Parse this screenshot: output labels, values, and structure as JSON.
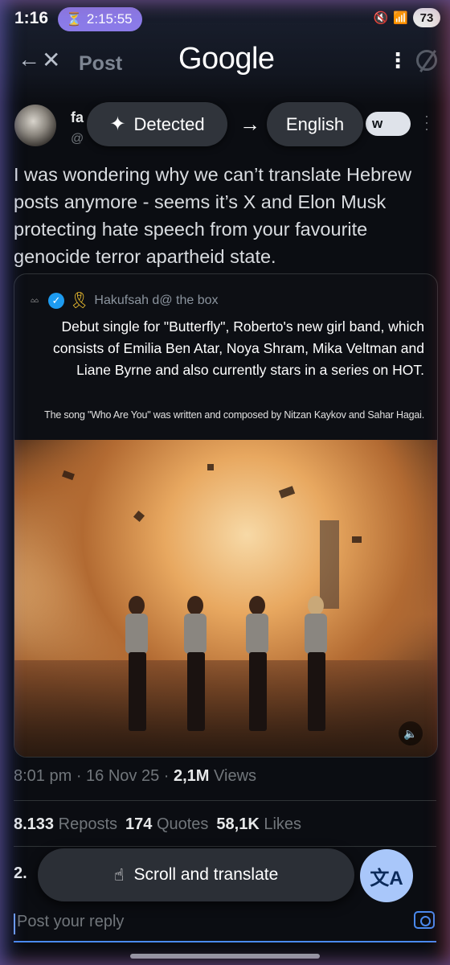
{
  "status_bar": {
    "time": "1:16",
    "timer": "2:15:55",
    "timer_icon": "hourglass-icon",
    "battery": "73"
  },
  "header": {
    "title": "Post",
    "logo": "Google"
  },
  "author": {
    "name_fragment": "fa",
    "handle_fragment": "@",
    "follow_fragment": "w"
  },
  "translate_bar": {
    "source": "Detected",
    "target": "English"
  },
  "post": {
    "text": "I was wondering why we can’t translate Hebrew posts anymore - seems it’s X and Elon Musk protecting hate speech from your favourite genocide terror apartheid state."
  },
  "quote": {
    "author": "Hakufsah d@ the box",
    "body": "Debut single for \"Butterfly\", Roberto's new girl band, which consists of Emilia Ben Atar, Noya Shram, Mika Veltman and Liane Byrne and also currently stars in a series on HOT.",
    "credit": "The song \"Who Are You\" was written and composed by Nitzan Kaykov and Sahar Hagai."
  },
  "meta": {
    "time": "8:01 pm",
    "date": "16 Nov 25",
    "views_count": "2,1M",
    "views_label": "Views"
  },
  "stats": {
    "reposts_count": "8.133",
    "reposts_label": "Reposts",
    "quotes_count": "174",
    "quotes_label": "Quotes",
    "likes_count": "58,1K",
    "likes_label": "Likes",
    "partial_count": "2."
  },
  "scroll_translate": {
    "label": "Scroll and translate"
  },
  "reply": {
    "placeholder": "Post your reply"
  },
  "colors": {
    "accent": "#1d9bf0",
    "timer_pill": "#8b7be8",
    "translate_fab": "#a9c7fa"
  }
}
